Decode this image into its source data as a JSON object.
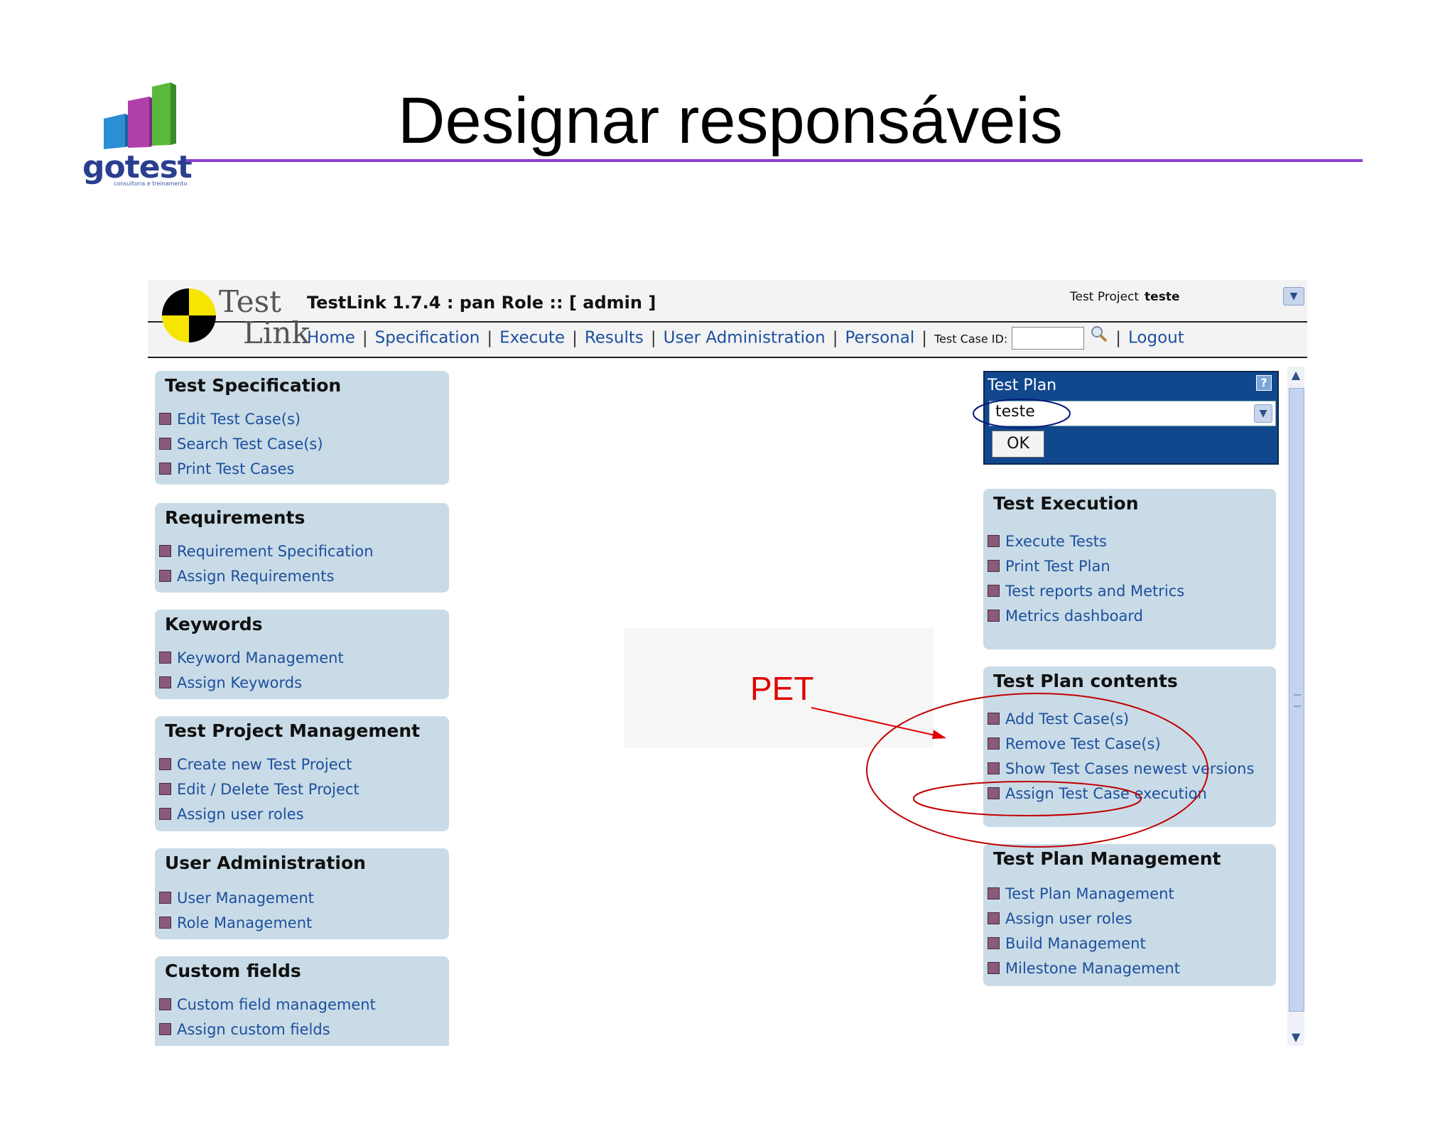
{
  "slide": {
    "title": "Designar responsáveis",
    "logo_text": "gotest",
    "logo_subtext": "consultoria e treinamento"
  },
  "testlink": {
    "logo_top": "Test",
    "logo_bottom": "Link",
    "title": "TestLink 1.7.4 : pan Role :: [ admin ]",
    "project_label": "Test Project",
    "project_value": "teste",
    "nav": {
      "home": "Home",
      "specification": "Specification",
      "execute": "Execute",
      "results": "Results",
      "user_administration": "User Administration",
      "personal": "Personal",
      "test_case_id_label": "Test Case ID:",
      "logout": "Logout"
    },
    "left_panels": [
      {
        "title": "Test Specification",
        "items": [
          "Edit Test Case(s)",
          "Search Test Case(s)",
          "Print Test Cases"
        ]
      },
      {
        "title": "Requirements",
        "items": [
          "Requirement Specification",
          "Assign Requirements"
        ]
      },
      {
        "title": "Keywords",
        "items": [
          "Keyword Management",
          "Assign Keywords"
        ]
      },
      {
        "title": "Test Project Management",
        "items": [
          "Create new Test Project",
          "Edit / Delete Test Project",
          "Assign user roles"
        ]
      },
      {
        "title": "User Administration",
        "items": [
          "User Management",
          "Role Management"
        ]
      },
      {
        "title": "Custom fields",
        "items": [
          "Custom field management",
          "Assign custom fields"
        ]
      }
    ],
    "test_plan": {
      "label": "Test Plan",
      "help": "?",
      "selected": "teste",
      "ok": "OK"
    },
    "right_panels": [
      {
        "title": "Test Execution",
        "items": [
          "Execute Tests",
          "Print Test Plan",
          "Test reports and Metrics",
          "Metrics dashboard"
        ]
      },
      {
        "title": "Test Plan contents",
        "items": [
          "Add Test Case(s)",
          "Remove Test Case(s)",
          "Show Test Cases newest versions",
          "Assign Test Case execution"
        ]
      },
      {
        "title": "Test Plan Management",
        "items": [
          "Test Plan Management",
          "Assign user roles",
          "Build Management",
          "Milestone Management"
        ]
      }
    ]
  },
  "annotation": {
    "label": "PET",
    "color": "#e00000"
  }
}
